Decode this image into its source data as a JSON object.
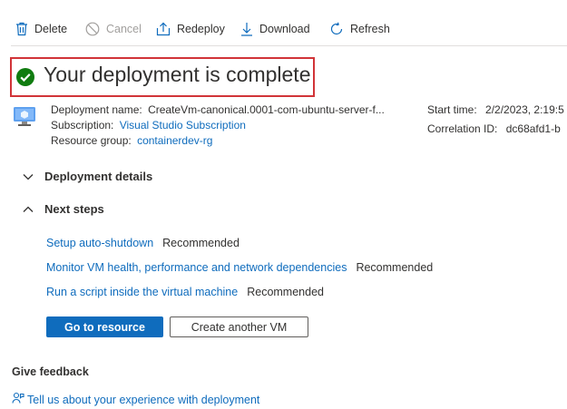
{
  "toolbar": {
    "delete_label": "Delete",
    "cancel_label": "Cancel",
    "redeploy_label": "Redeploy",
    "download_label": "Download",
    "refresh_label": "Refresh"
  },
  "status": {
    "title": "Your deployment is complete",
    "icon": "success-check-icon",
    "color": "#107c10"
  },
  "details": {
    "deployment_name_label": "Deployment name:",
    "deployment_name_value": "CreateVm-canonical.0001-com-ubuntu-server-f...",
    "subscription_label": "Subscription:",
    "subscription_value": "Visual Studio Subscription",
    "resource_group_label": "Resource group:",
    "resource_group_value": "containerdev-rg",
    "start_time_label": "Start time:",
    "start_time_value": "2/2/2023, 2:19:5",
    "correlation_id_label": "Correlation ID:",
    "correlation_id_value": "dc68afd1-b"
  },
  "sections": {
    "deployment_details_label": "Deployment details",
    "next_steps_label": "Next steps"
  },
  "next_steps": [
    {
      "link": "Setup auto-shutdown",
      "tag": "Recommended"
    },
    {
      "link": "Monitor VM health, performance and network dependencies",
      "tag": "Recommended"
    },
    {
      "link": "Run a script inside the virtual machine",
      "tag": "Recommended"
    }
  ],
  "actions": {
    "go_to_resource_label": "Go to resource",
    "create_another_label": "Create another VM"
  },
  "feedback": {
    "title": "Give feedback",
    "link_label": "Tell us about your experience with deployment"
  },
  "colors": {
    "accent": "#0f6cbd",
    "highlight_border": "#d13438"
  }
}
